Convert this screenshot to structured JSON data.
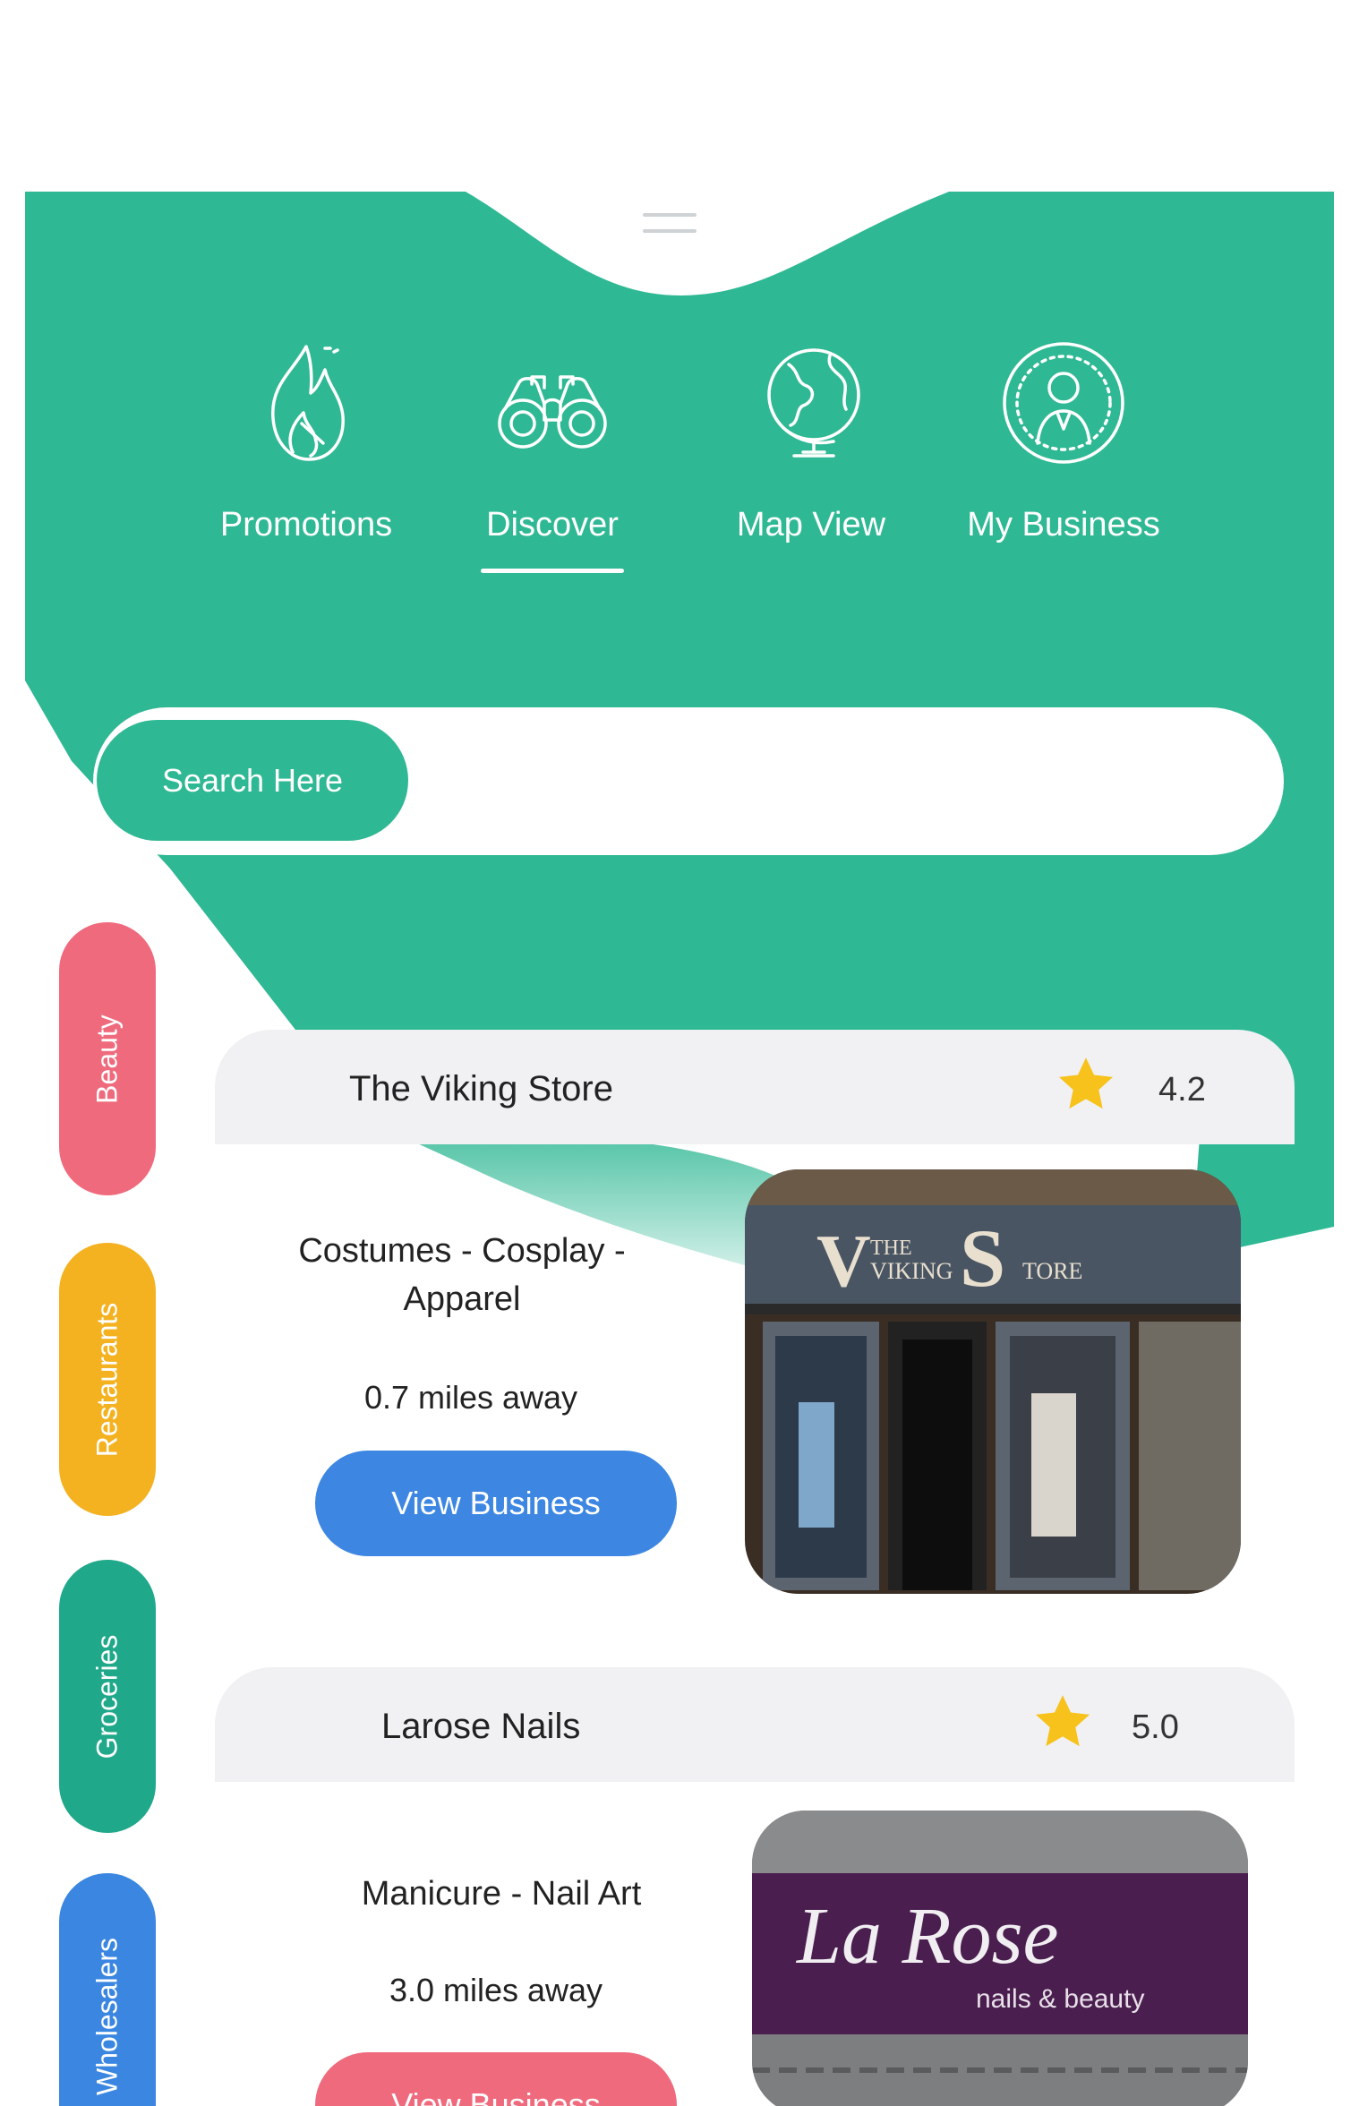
{
  "nav": {
    "tabs": [
      {
        "label": "Promotions",
        "icon": "flame-icon"
      },
      {
        "label": "Discover",
        "icon": "binoculars-icon"
      },
      {
        "label": "Map View",
        "icon": "globe-icon"
      },
      {
        "label": "My Business",
        "icon": "user-circle-icon"
      }
    ],
    "active": "Discover"
  },
  "search": {
    "button_label": "Search Here",
    "value": "",
    "placeholder": ""
  },
  "categories": [
    {
      "label": "Beauty",
      "color": "#ef6a7c"
    },
    {
      "label": "Restaurants",
      "color": "#f4b120"
    },
    {
      "label": "Groceries",
      "color": "#1fa88a"
    },
    {
      "label": "Wholesalers",
      "color": "#3a86e0"
    }
  ],
  "businesses": [
    {
      "name": "The Viking Store",
      "rating": "4.2",
      "category_line1": "Costumes - Cosplay -",
      "category_line2": "Apparel",
      "distance": "0.7 miles away",
      "button_label": "View Business",
      "button_color": "#3d87e2",
      "photo_sign": "The Viking Store"
    },
    {
      "name": "Larose Nails",
      "rating": "5.0",
      "category_line1": "Manicure - Nail Art",
      "category_line2": "",
      "distance": "3.0 miles away",
      "button_label": "View Business",
      "button_color": "#ef6a7c",
      "photo_sign": "La Rose",
      "photo_sign_sub": "nails & beauty"
    }
  ],
  "colors": {
    "brand_green": "#2fb894",
    "card_header": "#f1f1f4",
    "star": "#f6c21b"
  }
}
